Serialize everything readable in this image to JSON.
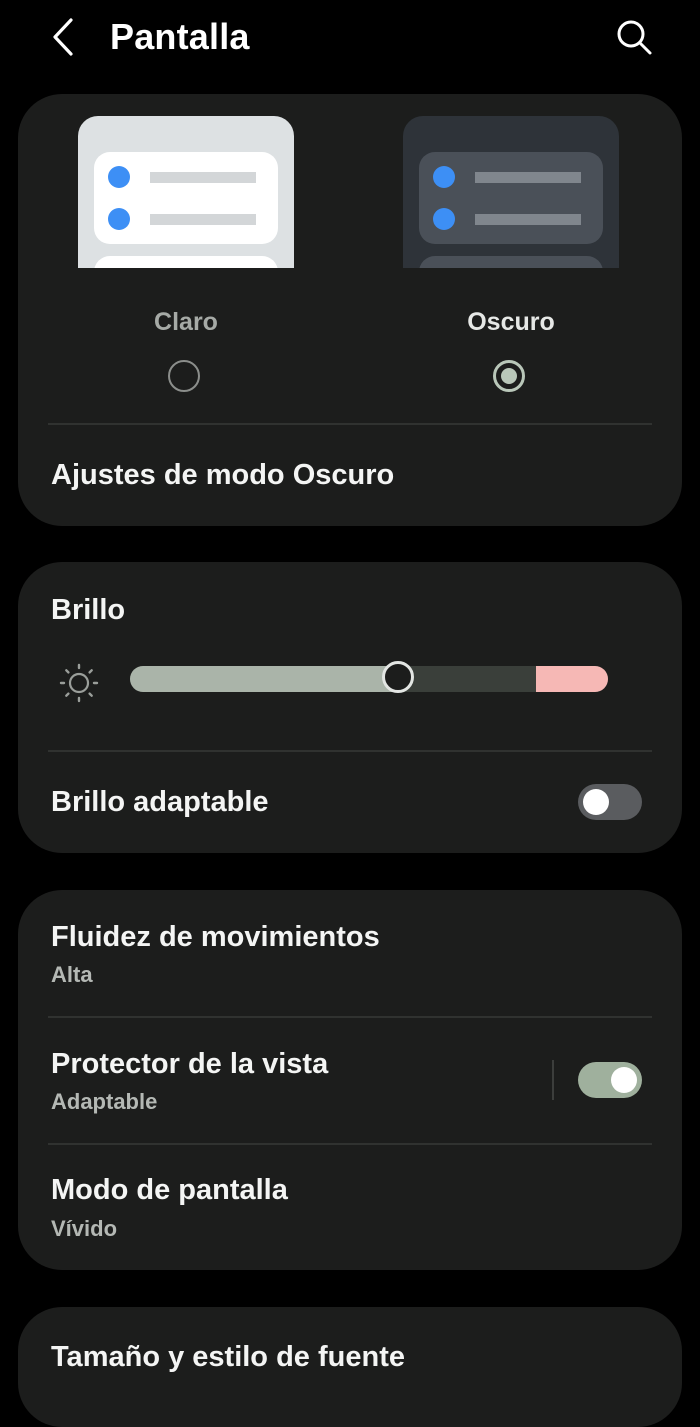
{
  "header": {
    "title": "Pantalla",
    "back_icon": "chevron-left-icon",
    "search_icon": "search-icon"
  },
  "theme": {
    "options": [
      {
        "label": "Claro",
        "selected": false
      },
      {
        "label": "Oscuro",
        "selected": true
      }
    ],
    "dark_mode_settings_label": "Ajustes de modo Oscuro"
  },
  "brightness": {
    "title": "Brillo",
    "icon": "sun-icon",
    "level": 0.56,
    "adaptive_label": "Brillo adaptable",
    "adaptive_on": false
  },
  "display": {
    "motion_smoothness": {
      "title": "Fluidez de movimientos",
      "value": "Alta"
    },
    "eye_comfort": {
      "title": "Protector de la vista",
      "value": "Adaptable",
      "on": true
    },
    "screen_mode": {
      "title": "Modo de pantalla",
      "value": "Vívido"
    }
  },
  "font": {
    "title": "Tamaño y estilo de fuente"
  },
  "colors": {
    "background": "#000000",
    "card": "#1c1d1c",
    "accent": "#aab4a9",
    "dot_blue": "#3d8ff5",
    "slider_over": "#f6b8b5"
  }
}
